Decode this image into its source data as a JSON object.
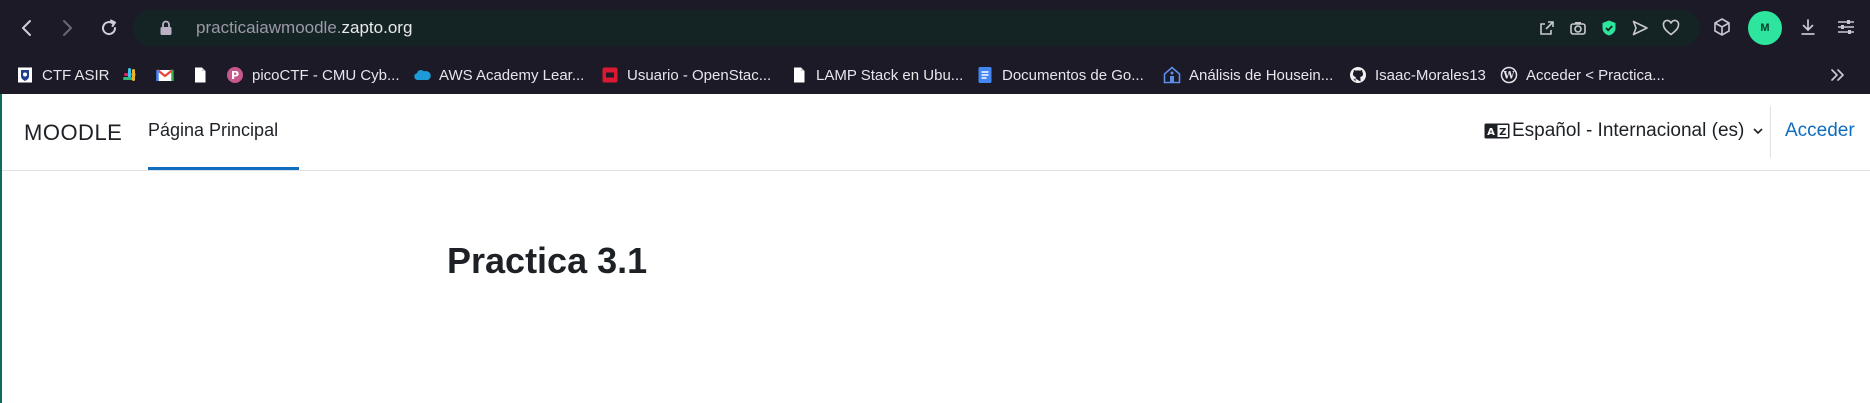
{
  "browser": {
    "url_prefix": "practicaiawmoodle.",
    "url_domain": "zapto.org",
    "avatar_initial": "M",
    "bookmarks": [
      {
        "label": "CTF ASIR",
        "icon": "shield-crest-icon"
      },
      {
        "label": "",
        "icon": "slack-icon"
      },
      {
        "label": "",
        "icon": "gmail-icon"
      },
      {
        "label": "",
        "icon": "document-icon"
      },
      {
        "label": "picoCTF - CMU Cyb...",
        "icon": "picoctf-icon"
      },
      {
        "label": "AWS Academy Lear...",
        "icon": "salesforce-cloud-icon"
      },
      {
        "label": "Usuario - OpenStac...",
        "icon": "openstack-icon"
      },
      {
        "label": "LAMP Stack en Ubu...",
        "icon": "document-icon"
      },
      {
        "label": "Documentos de Go...",
        "icon": "google-docs-icon"
      },
      {
        "label": "Análisis de Housein...",
        "icon": "house-icon"
      },
      {
        "label": "Isaac-Morales13",
        "icon": "github-icon"
      },
      {
        "label": "Acceder < Practica...",
        "icon": "wordpress-icon"
      }
    ]
  },
  "moodle": {
    "brand": "MOODLE",
    "nav_home": "Página Principal",
    "language": "Español - Internacional (es)",
    "login": "Acceder",
    "page_title": "Practica 3.1"
  },
  "colors": {
    "browser_bg": "#1d1a28",
    "address_bar": "#142425",
    "avatar": "#2ee59d",
    "moodle_link": "#0f6cbf"
  }
}
